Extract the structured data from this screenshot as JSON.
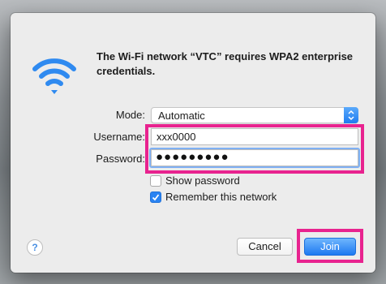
{
  "dialog": {
    "message": "The Wi-Fi network “VTC” requires WPA2 enterprise credentials."
  },
  "form": {
    "mode_label": "Mode:",
    "mode_value": "Automatic",
    "username_label": "Username:",
    "username_value": "xxx0000",
    "password_label": "Password:",
    "password_masked": "●●●●●●●●●"
  },
  "options": {
    "show_password_label": "Show password",
    "show_password_checked": false,
    "remember_label": "Remember this network",
    "remember_checked": true
  },
  "buttons": {
    "help_label": "?",
    "cancel_label": "Cancel",
    "join_label": "Join"
  },
  "icons": {
    "wifi": "wifi-icon",
    "select_arrows": "chevron-updown-icon",
    "checkmark": "checkmark-icon"
  },
  "colors": {
    "accent_blue": "#1e7cf0",
    "highlight_pink": "#e8238f",
    "focus_ring": "#7fb0f3"
  }
}
